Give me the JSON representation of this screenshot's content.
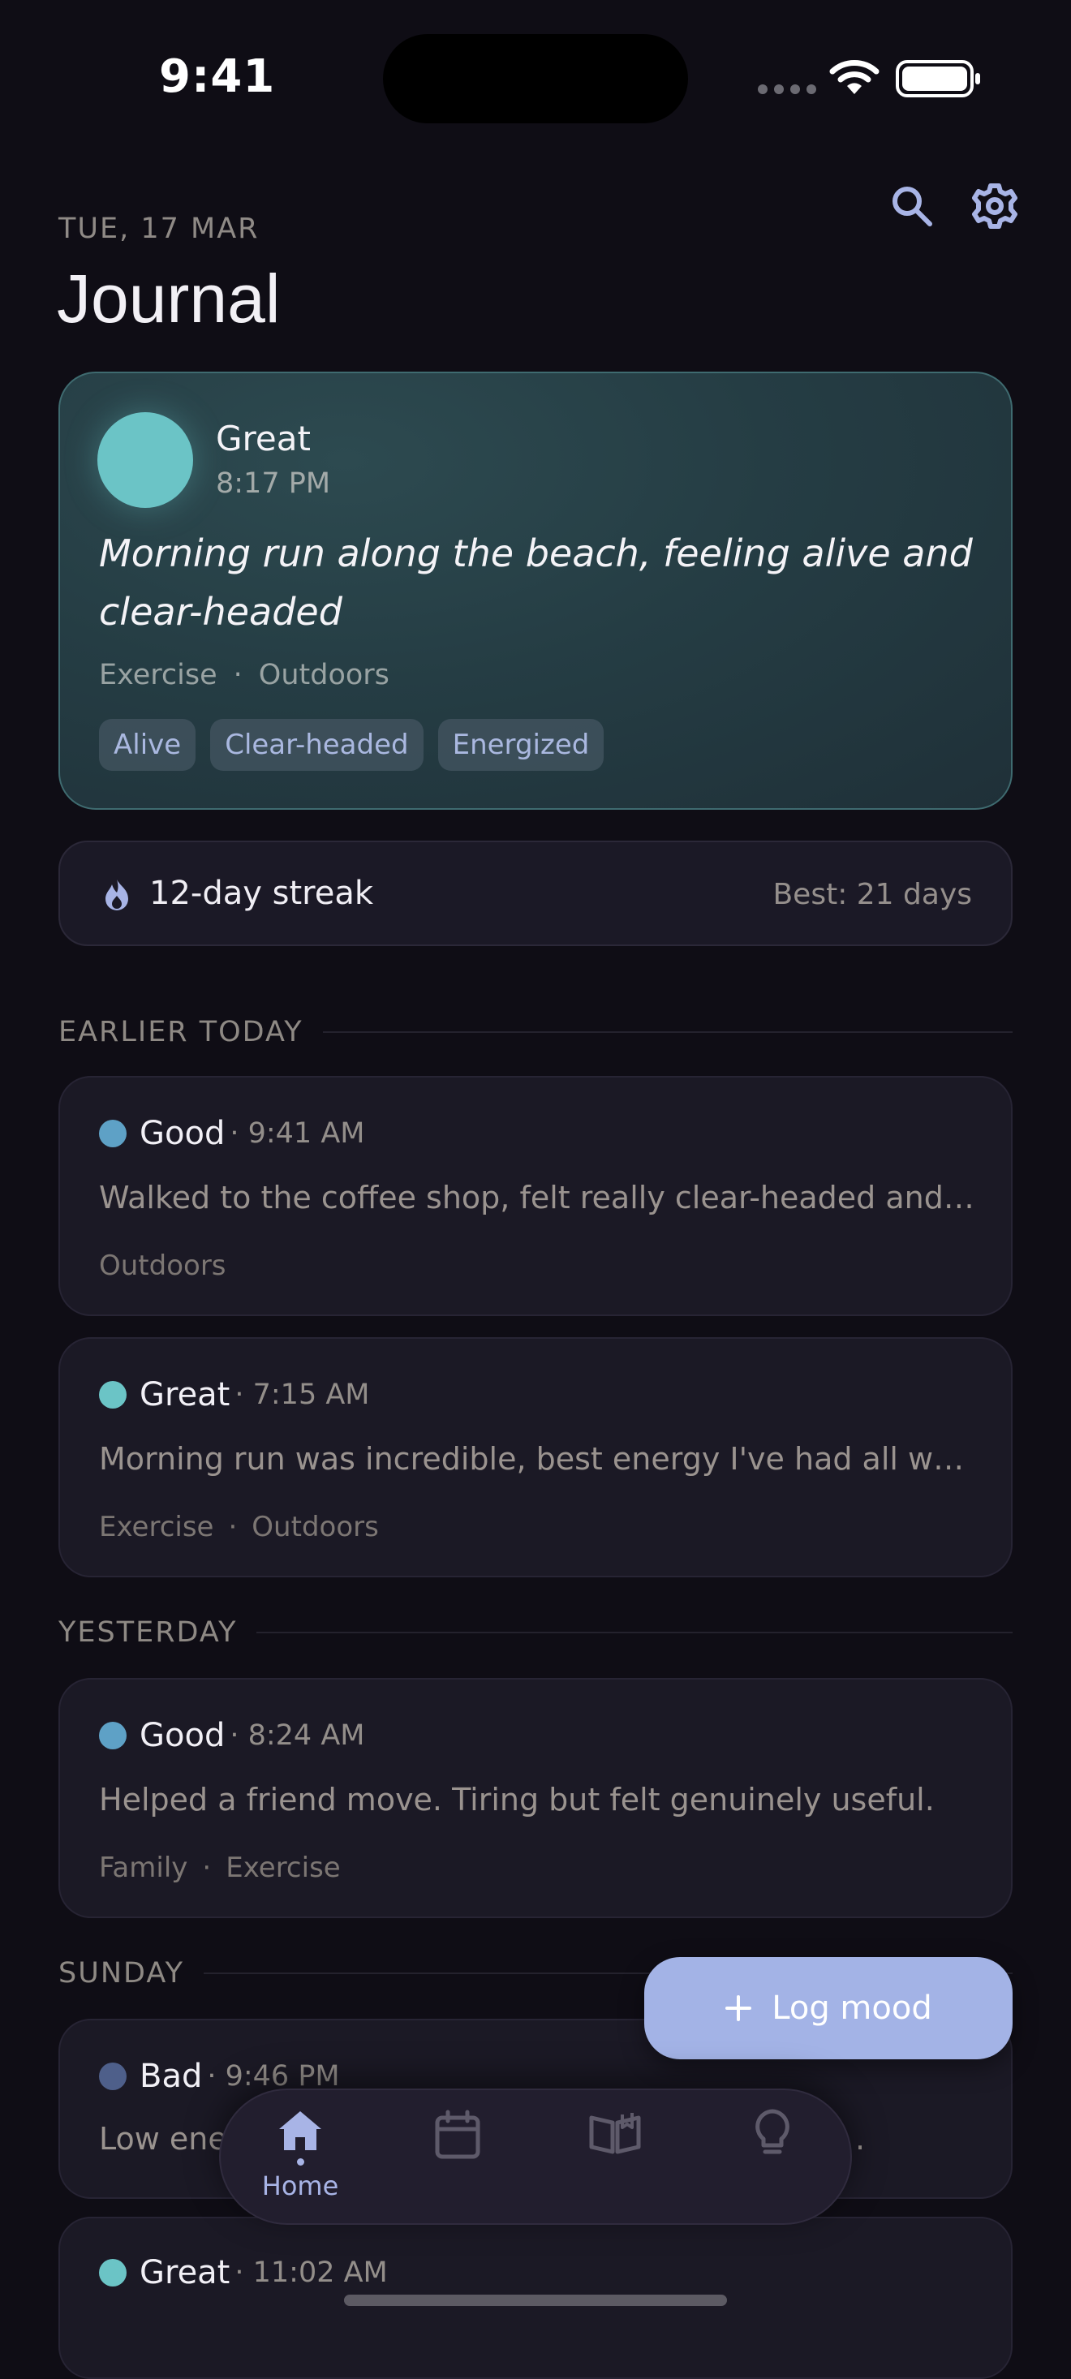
{
  "status_bar": {
    "time": "9:41"
  },
  "header": {
    "date": "TUE, 17 MAR",
    "title": "Journal"
  },
  "featured": {
    "mood": "Great",
    "time": "8:17 PM",
    "note": "Morning run along the beach, feeling alive and clear-headed",
    "activities": [
      "Exercise",
      "Outdoors"
    ],
    "separator": "·",
    "tags": [
      "Alive",
      "Clear-headed",
      "Energized"
    ],
    "color": "#6bc4c6"
  },
  "streak": {
    "label": "12-day streak",
    "best": "Best: 21 days"
  },
  "sections": {
    "earlier_today": "EARLIER TODAY",
    "yesterday": "YESTERDAY",
    "sunday": "SUNDAY"
  },
  "entries": [
    {
      "mood": "Good",
      "time": "· 9:41 AM",
      "note": "Walked to the coffee shop, felt really clear-headed and ...",
      "activities": [
        "Outdoors"
      ],
      "color": "#5ea1c6"
    },
    {
      "mood": "Great",
      "time": "· 7:15 AM",
      "note": "Morning run was incredible, best energy I've had all we...",
      "activities": [
        "Exercise",
        "Outdoors"
      ],
      "color": "#6bc4c6"
    },
    {
      "mood": "Good",
      "time": "· 8:24 AM",
      "note": "Helped a friend move. Tiring but felt genuinely useful.",
      "activities": [
        "Family",
        "Exercise"
      ],
      "color": "#5ea1c6"
    },
    {
      "mood": "Bad",
      "time": "· 9:46 PM",
      "note": "Low ene",
      "note_tail": ".",
      "activities": [],
      "color": "#4e5f8a"
    },
    {
      "mood": "Great",
      "time": "· 11:02 AM",
      "note": "",
      "activities": [],
      "color": "#6bc4c6"
    }
  ],
  "fab": {
    "label": "Log mood",
    "icon": "plus-icon"
  },
  "tabbar": {
    "tabs": [
      {
        "label": "Home",
        "icon": "home-icon",
        "active": true
      },
      {
        "label": "",
        "icon": "calendar-icon",
        "active": false
      },
      {
        "label": "",
        "icon": "book-icon",
        "active": false
      },
      {
        "label": "",
        "icon": "lightbulb-icon",
        "active": false
      }
    ]
  },
  "colors": {
    "accent": "#a8b4e6",
    "background": "#0f0d15",
    "card": "#1b1925"
  }
}
